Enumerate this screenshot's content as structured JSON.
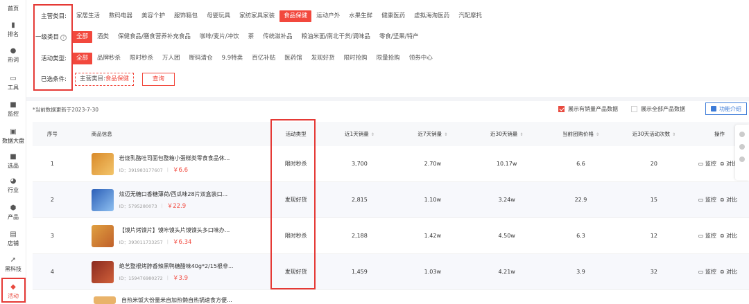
{
  "sidebar": {
    "items": [
      {
        "label": "首页",
        "icon": "home-icon"
      },
      {
        "label": "排名",
        "icon": "rank-icon"
      },
      {
        "label": "热词",
        "icon": "hotword-icon"
      },
      {
        "label": "工具",
        "icon": "tool-icon"
      },
      {
        "label": "监控",
        "icon": "monitor-icon"
      },
      {
        "label": "数据大盘",
        "icon": "dashboard-icon"
      },
      {
        "label": "选品",
        "icon": "select-icon"
      },
      {
        "label": "行业",
        "icon": "industry-icon"
      },
      {
        "label": "产品",
        "icon": "product-icon"
      },
      {
        "label": "店铺",
        "icon": "shop-icon"
      },
      {
        "label": "黑科技",
        "icon": "blacktech-icon"
      },
      {
        "label": "活动",
        "icon": "activity-icon"
      }
    ]
  },
  "filters": {
    "main_category": {
      "label": "主营类目:",
      "options": [
        "家居生活",
        "数码电器",
        "美容个护",
        "服饰箱包",
        "母婴玩具",
        "家纺家具家装",
        "食品保健",
        "运动户外",
        "水果生鲜",
        "健康医药",
        "虚拟海淘医药",
        "汽配摩托"
      ],
      "active": 6
    },
    "primary_category": {
      "label": "一级类目",
      "options": [
        "全部",
        "酒类",
        "保健食品/膳食营养补充食品",
        "咖啡/麦片/冲饮",
        "茶",
        "传统滋补品",
        "粮油米面/南北干货/调味品",
        "零食/坚果/特产"
      ],
      "active": 0
    },
    "activity_type": {
      "label": "活动类型:",
      "options": [
        "全部",
        "品牌秒杀",
        "限时秒杀",
        "万人团",
        "断码清仓",
        "9.9特卖",
        "百亿补贴",
        "医药馆",
        "发现好货",
        "限时抢购",
        "限量抢购",
        "领券中心"
      ],
      "active": 0
    },
    "selected": {
      "label": "已选条件:",
      "prefix": "主营类目:",
      "value": "食品保健",
      "query_label": "查询"
    }
  },
  "info": {
    "update_note": "*当前数据更新于2023-7-30",
    "show_sales_label": "展示有销量产品数据",
    "show_sales_checked": true,
    "show_all_label": "展示全部产品数据",
    "show_all_checked": false,
    "func_intro_label": "功能介绍"
  },
  "table": {
    "headers": {
      "idx": "序号",
      "product": "商品信息",
      "activity": "活动类型",
      "d1": "近1天销量",
      "d7": "近7天销量",
      "d30": "近30天销量",
      "price": "当前团购价格",
      "times": "近30天活动次数",
      "ops": "操作"
    },
    "rows": [
      {
        "idx": "1",
        "name": "岩烧乳酪吐司面包整箱小蛋糕类零食食品休...",
        "id": "ID：391983177607",
        "price": "￥6.6",
        "activity": "限时秒杀",
        "d1": "3,700",
        "d7": "2.70w",
        "d30": "10.17w",
        "cur_price": "6.6",
        "times": "20",
        "thumb": "#d98a2a"
      },
      {
        "idx": "2",
        "name": "炫迈无糖口香糖薄荷/西瓜味28片双盒装口...",
        "id": "ID：5795280073",
        "price": "￥22.9",
        "activity": "发现好货",
        "d1": "2,815",
        "d7": "1.10w",
        "d30": "3.24w",
        "cur_price": "22.9",
        "times": "15",
        "thumb": "#3f7fd1"
      },
      {
        "idx": "3",
        "name": "【馍片烤馍片】馍咔馍头片馍馍头多口味办...",
        "id": "ID：393011733257",
        "price": "￥6.34",
        "activity": "限时秒杀",
        "d1": "2,188",
        "d7": "1.42w",
        "d30": "4.50w",
        "cur_price": "6.3",
        "times": "12",
        "thumb": "#e0a040"
      },
      {
        "idx": "4",
        "name": "绝艺整根烤脖香辣黑鸭糖醋味40g*2/15根非...",
        "id": "ID：159476980272",
        "price": "￥3.9",
        "activity": "发现好货",
        "d1": "1,459",
        "d7": "1.03w",
        "d30": "4.21w",
        "cur_price": "3.9",
        "times": "32",
        "thumb": "#8a2a1f"
      }
    ],
    "partial_row_name": "自热米饭大份量米自加热懒自热锅速食方便...",
    "op_monitor": "监控",
    "op_compare": "对比"
  }
}
